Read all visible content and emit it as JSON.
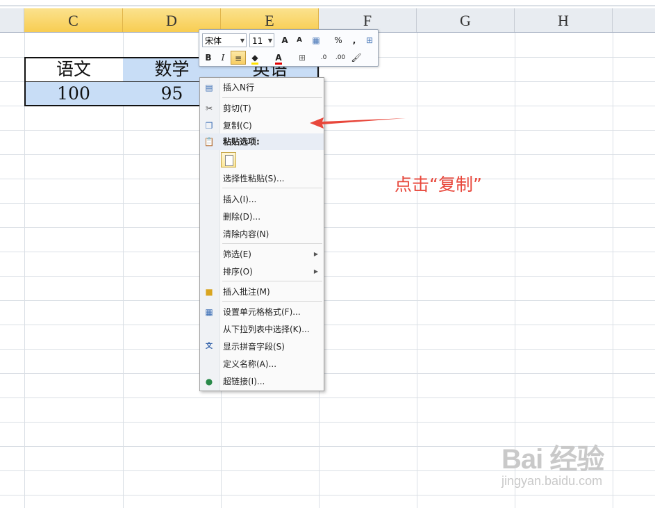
{
  "columns": [
    "C",
    "D",
    "E",
    "F",
    "G",
    "H"
  ],
  "table": {
    "headers": [
      "语文",
      "数学",
      "英语"
    ],
    "values": [
      "100",
      "95",
      ""
    ]
  },
  "mini_toolbar": {
    "font_name": "宋体",
    "font_size": "11",
    "grow_font": "A",
    "shrink_font": "A",
    "percent": "%",
    "comma": ",",
    "bold": "B",
    "italic": "I",
    "font_color": "A",
    "inc_decimal": ".0",
    "dec_decimal": ".00"
  },
  "context_menu": {
    "items": [
      "插入N行",
      "剪切(T)",
      "复制(C)",
      "粘贴选项:",
      "选择性粘贴(S)...",
      "插入(I)...",
      "删除(D)...",
      "清除内容(N)",
      "筛选(E)",
      "排序(O)",
      "插入批注(M)",
      "设置单元格格式(F)...",
      "从下拉列表中选择(K)...",
      "显示拼音字段(S)",
      "定义名称(A)...",
      "超链接(I)..."
    ]
  },
  "annotation": "点击“复制”",
  "watermark": {
    "brand": "Bai 经验",
    "url": "jingyan.baidu.com"
  },
  "colors": {
    "selected_header": "#f8cd52",
    "selected_cell": "#c8ddf6",
    "annotation_red": "#e8473b"
  }
}
